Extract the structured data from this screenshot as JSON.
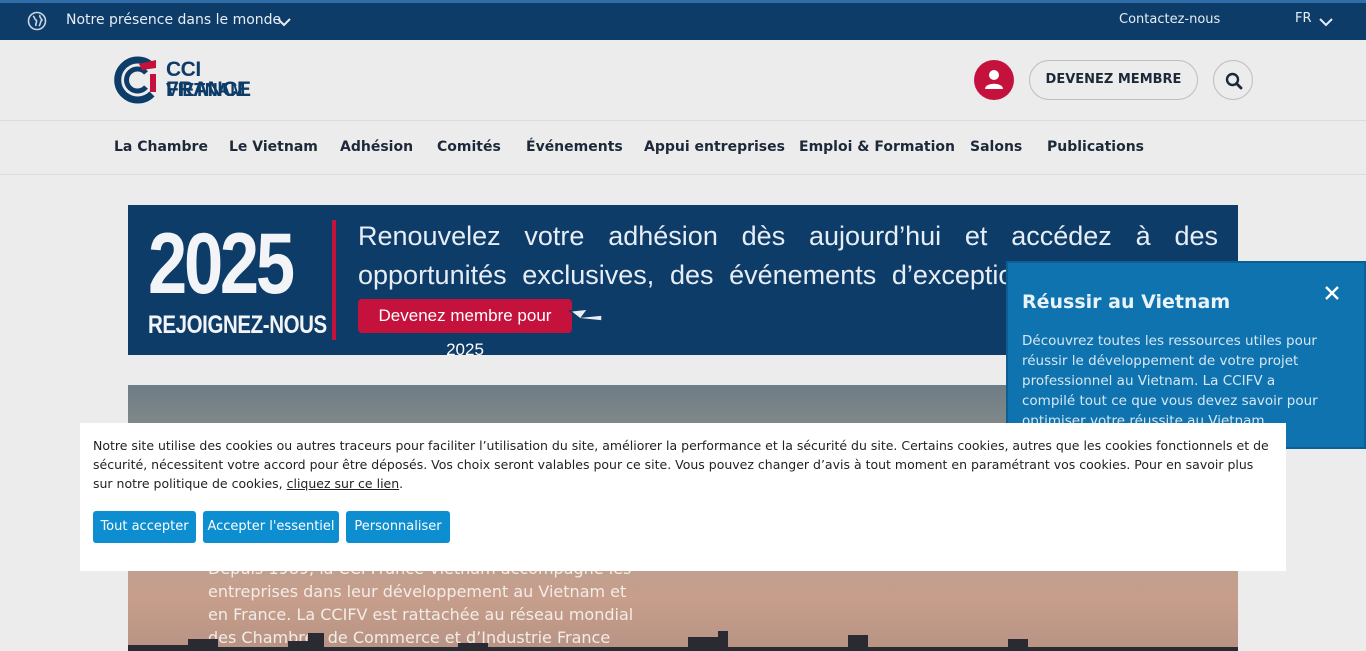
{
  "topbar": {
    "presence_label": "Notre présence dans le monde",
    "contact_label": "Contactez-nous",
    "lang_label": "FR"
  },
  "header": {
    "logo_line1": "CCI FRANCE",
    "logo_line2": "VIETNAM",
    "member_button": "DEVENEZ MEMBRE"
  },
  "nav": {
    "items": [
      {
        "label": "La Chambre"
      },
      {
        "label": "Le Vietnam"
      },
      {
        "label": "Adhésion"
      },
      {
        "label": "Comités"
      },
      {
        "label": "Événements"
      },
      {
        "label": "Appui entreprises"
      },
      {
        "label": "Emploi & Formation"
      },
      {
        "label": "Salons"
      },
      {
        "label": "Publications"
      }
    ]
  },
  "banner": {
    "year": "2025",
    "join": "REJOIGNEZ-NOUS",
    "text": "Renouvelez votre adhésion dès aujourd’hui et accédez à des opportunités exclusives, des événements d’exception, et un réseau d’affaires d",
    "cta": "Devenez membre pour 2025"
  },
  "hero": {
    "description": "Depuis 1989, la CCI France Vietnam accompagne les entreprises dans leur développement au Vietnam et en France. La CCIFV est rattachée au réseau mondial des Chambres de Commerce et d’Industrie France"
  },
  "side_panel": {
    "title": "Réussir au Vietnam",
    "body": "Découvrez toutes les ressources utiles pour réussir le développement de votre projet professionnel au Vietnam. La CCIFV a compilé tout ce que vous devez savoir pour optimiser votre réussite au Vietnam."
  },
  "cookie": {
    "message": "Notre site utilise des cookies ou autres traceurs pour faciliter l’utilisation du site, améliorer la performance et la sécurité du site. Certains cookies, autres que les cookies fonctionnels et de sécurité, nécessitent votre accord pour être déposés. Vos choix seront valables pour ce site. Vous pouvez changer d’avis à tout moment en paramétrant vos cookies. Pour en savoir plus sur notre politique de cookies, ",
    "link": "cliquez sur ce lien",
    "buttons": {
      "accept_all": "Tout accepter",
      "accept_essential": "Accepter l'essentiel",
      "customize": "Personnaliser"
    }
  },
  "colors": {
    "navy": "#0d3c68",
    "brand_red": "#c5123d",
    "panel_blue": "#0f73b0",
    "cookie_button": "#0c8ed1"
  },
  "icons": [
    "globe-icon",
    "chevron-down-icon",
    "user-icon",
    "search-icon",
    "close-icon",
    "cursor-arrow-icon"
  ]
}
